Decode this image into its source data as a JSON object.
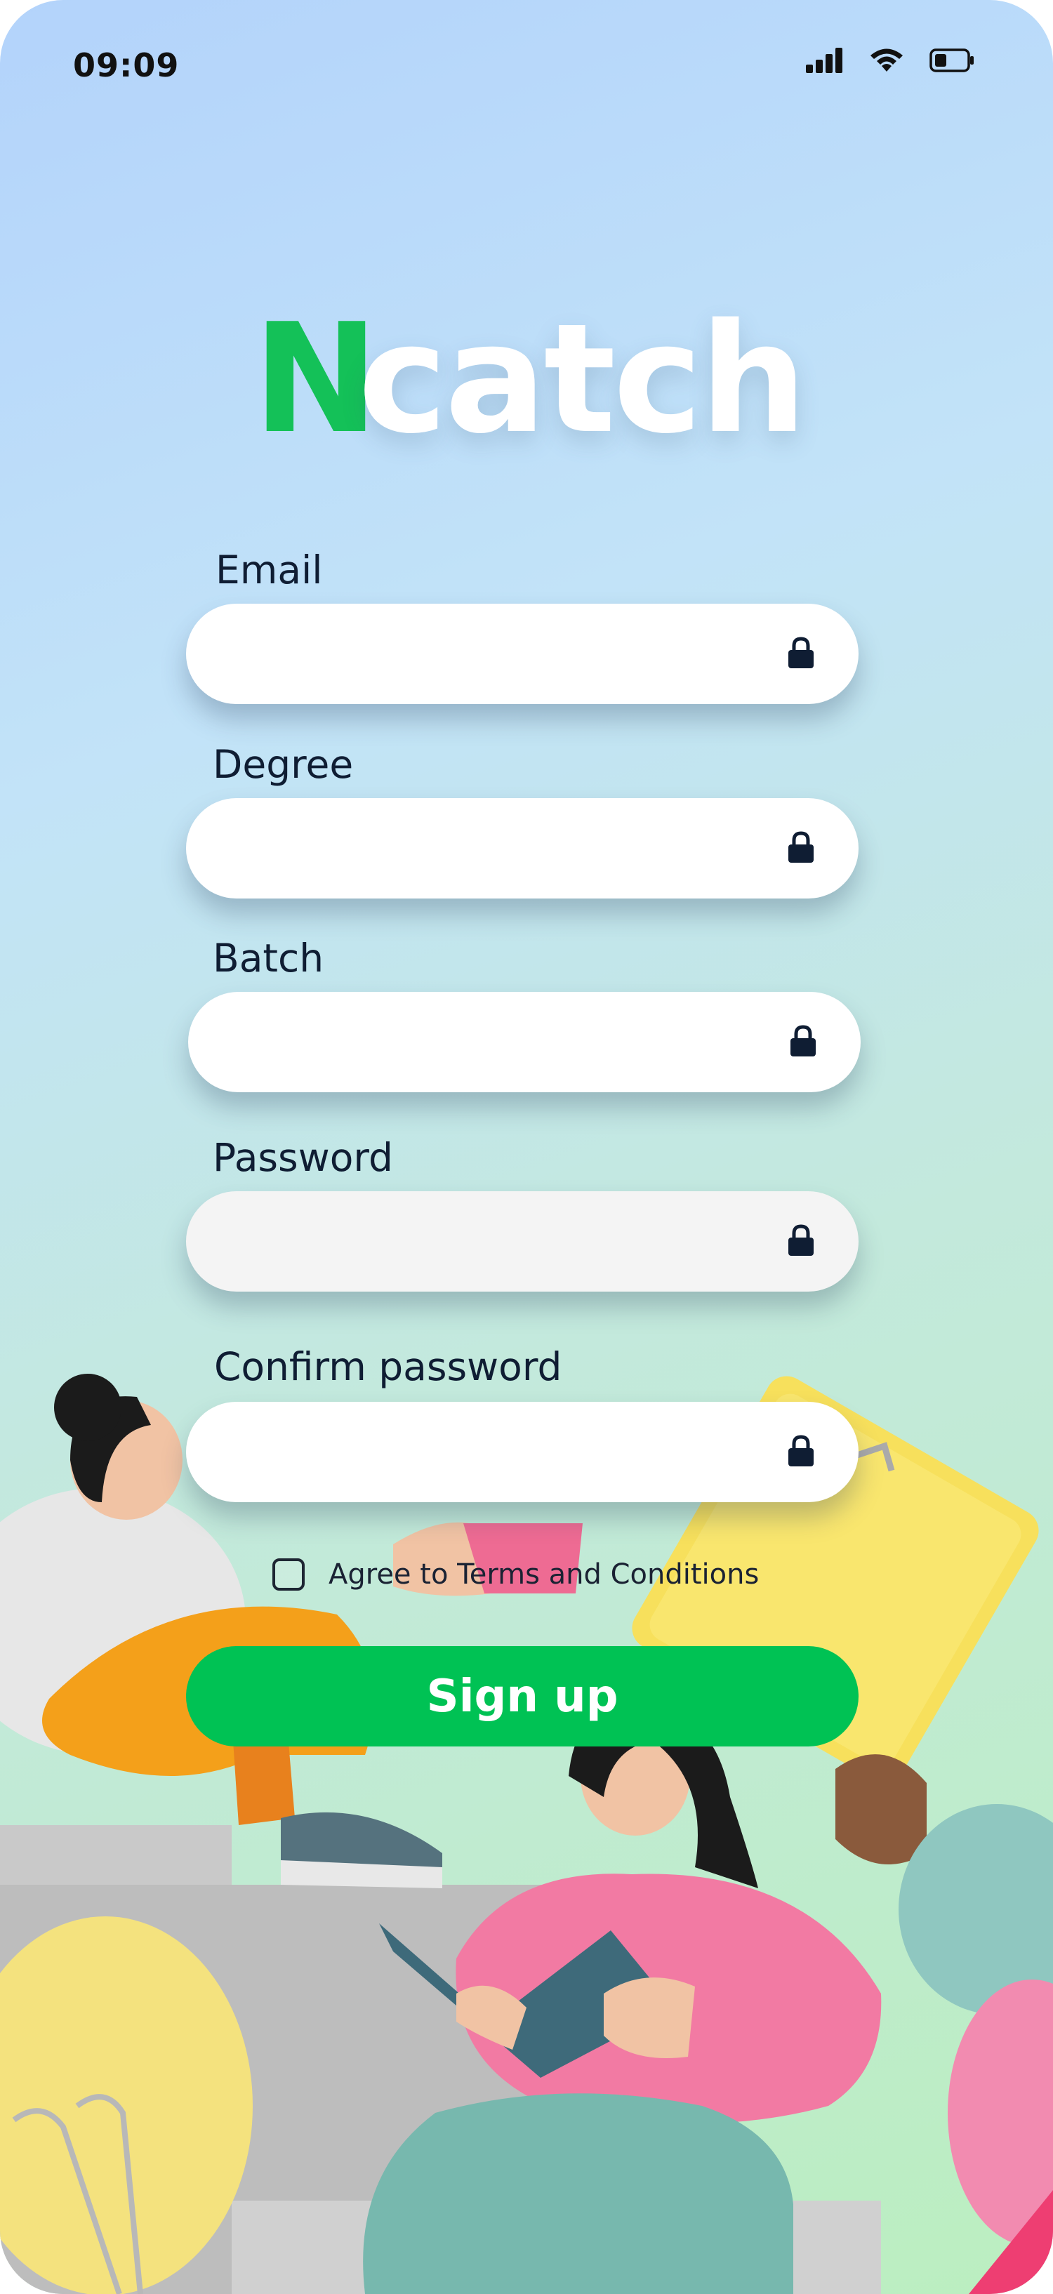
{
  "status_bar": {
    "time": "09:09",
    "icons": [
      "signal-icon",
      "wifi-icon",
      "battery-icon"
    ]
  },
  "brand": {
    "logo_first": "N",
    "logo_rest": "catch",
    "accent_color": "#14c158"
  },
  "form": {
    "fields": [
      {
        "label": "Email",
        "value": "",
        "icon": "lock-icon"
      },
      {
        "label": "Degree",
        "value": "",
        "icon": "lock-icon"
      },
      {
        "label": "Batch",
        "value": "",
        "icon": "lock-icon"
      },
      {
        "label": "Password",
        "value": "",
        "icon": "lock-icon"
      },
      {
        "label": "Confirm password",
        "value": "",
        "icon": "lock-icon"
      }
    ],
    "terms_label": "Agree to Terms and Conditions",
    "terms_checked": false,
    "submit_label": "Sign up",
    "submit_color": "#00c254"
  }
}
